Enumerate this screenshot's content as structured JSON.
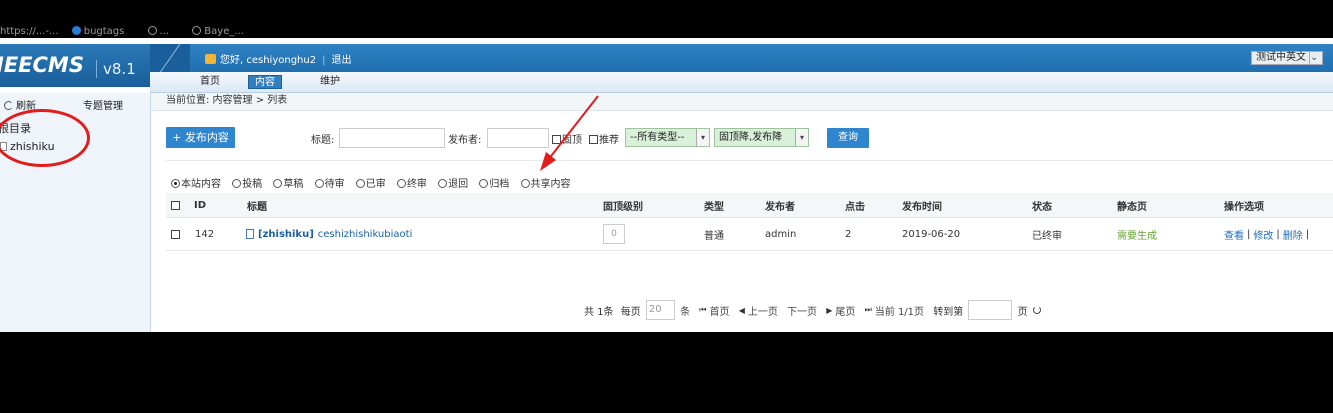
{
  "browser": {
    "bookmarks": [
      "https://...-...",
      "bugtags",
      "...",
      "Baye_..."
    ]
  },
  "header": {
    "logo": "JEECMS",
    "version": "v8.1",
    "greeting": "您好, ceshiyonghu2",
    "logout": "退出",
    "language_button": "测试中英文",
    "nav_tabs": [
      {
        "label": "首页",
        "active": false
      },
      {
        "label": "内容",
        "active": true
      },
      {
        "label": "维护",
        "active": false
      }
    ]
  },
  "sidebar": {
    "refresh": "刷新",
    "topic_manage": "专题管理",
    "tree_root": "根目录",
    "tree_child": "zhishiku"
  },
  "main": {
    "breadcrumb": "当前位置: 内容管理 > 列表",
    "toolbar": {
      "publish_button": "+ 发布内容",
      "title_label": "标题:",
      "title_value": "",
      "publisher_label": "发布者:",
      "publisher_value": "",
      "fixed_top_label": "固顶",
      "recommend_label": "推荐",
      "type_select": "--所有类型--",
      "sort_select": "固顶降,发布降",
      "query_button": "查询"
    },
    "filters": [
      {
        "label": "本站内容",
        "checked": true
      },
      {
        "label": "投稿",
        "checked": false
      },
      {
        "label": "草稿",
        "checked": false
      },
      {
        "label": "待审",
        "checked": false
      },
      {
        "label": "已审",
        "checked": false
      },
      {
        "label": "终审",
        "checked": false
      },
      {
        "label": "退回",
        "checked": false
      },
      {
        "label": "归档",
        "checked": false
      },
      {
        "label": "共享内容",
        "checked": false
      }
    ],
    "table": {
      "headers": {
        "id": "ID",
        "title": "标题",
        "top_level": "固顶级别",
        "type": "类型",
        "publisher": "发布者",
        "clicks": "点击",
        "publish_time": "发布时间",
        "status": "状态",
        "static_page": "静态页",
        "operations": "操作选项"
      },
      "rows": [
        {
          "id": "142",
          "channel_tag": "[zhishiku]",
          "title": "ceshizhishikubiaoti",
          "top_level": "0",
          "type": "普通",
          "publisher": "admin",
          "clicks": "2",
          "publish_time": "2019-06-20",
          "status": "已终审",
          "static_page": "需要生成",
          "ops": [
            "查看",
            "修改",
            "删除"
          ]
        }
      ]
    },
    "pager": {
      "total": "共 1条",
      "per_page_label": "每页",
      "per_page_value": "20",
      "unit": "条",
      "first": "首页",
      "prev": "上一页",
      "next": "下一页",
      "last": "尾页",
      "current": "当前 1/1页",
      "goto": "转到第",
      "page": "页"
    }
  },
  "annotations": {
    "color": "#e21b1b"
  }
}
